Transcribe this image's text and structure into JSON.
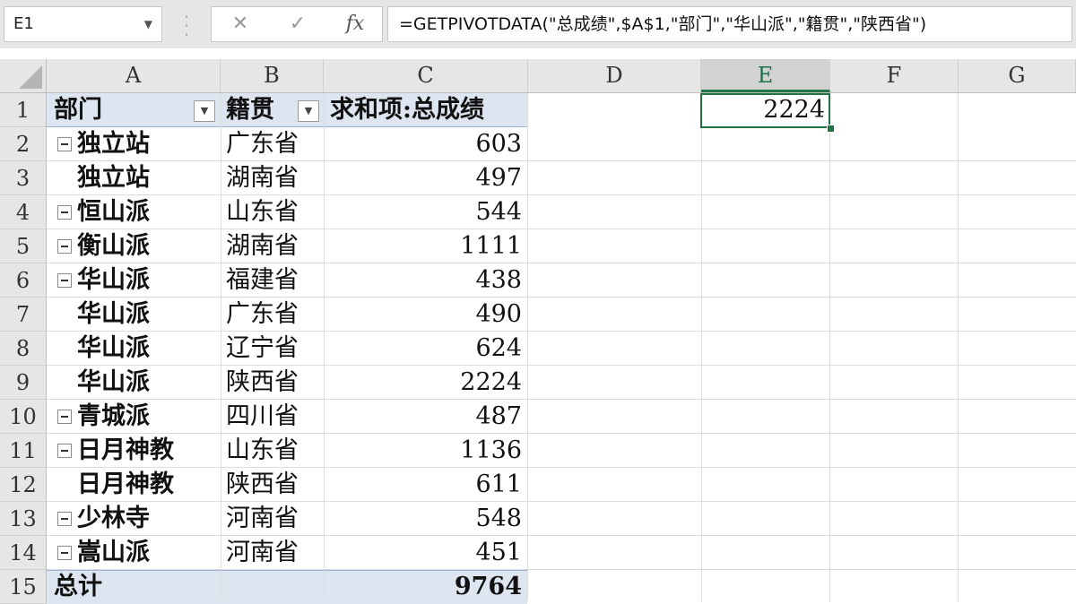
{
  "name_box": {
    "value": "E1"
  },
  "formula_bar": {
    "cancel_icon": "✕",
    "enter_icon": "✓",
    "fx_label": "fx",
    "formula": "=GETPIVOTDATA(\"总成绩\",$A$1,\"部门\",\"华山派\",\"籍贯\",\"陕西省\")"
  },
  "columns": [
    "A",
    "B",
    "C",
    "D",
    "E",
    "F",
    "G"
  ],
  "active_column": "E",
  "rows": [
    "1",
    "2",
    "3",
    "4",
    "5",
    "6",
    "7",
    "8",
    "9",
    "10",
    "11",
    "12",
    "13",
    "14",
    "15"
  ],
  "pivot": {
    "headers": {
      "dept": "部门",
      "origin": "籍贯",
      "sum": "求和项:总成绩"
    },
    "rows": [
      {
        "dept": "独立站",
        "origin": "广东省",
        "value": "603",
        "group_start": true
      },
      {
        "dept": "独立站",
        "origin": "湖南省",
        "value": "497",
        "group_start": false
      },
      {
        "dept": "恒山派",
        "origin": "山东省",
        "value": "544",
        "group_start": true
      },
      {
        "dept": "衡山派",
        "origin": "湖南省",
        "value": "1111",
        "group_start": true
      },
      {
        "dept": "华山派",
        "origin": "福建省",
        "value": "438",
        "group_start": true
      },
      {
        "dept": "华山派",
        "origin": "广东省",
        "value": "490",
        "group_start": false
      },
      {
        "dept": "华山派",
        "origin": "辽宁省",
        "value": "624",
        "group_start": false
      },
      {
        "dept": "华山派",
        "origin": "陕西省",
        "value": "2224",
        "group_start": false
      },
      {
        "dept": "青城派",
        "origin": "四川省",
        "value": "487",
        "group_start": true
      },
      {
        "dept": "日月神教",
        "origin": "山东省",
        "value": "1136",
        "group_start": true
      },
      {
        "dept": "日月神教",
        "origin": "陕西省",
        "value": "611",
        "group_start": false
      },
      {
        "dept": "少林寺",
        "origin": "河南省",
        "value": "548",
        "group_start": true
      },
      {
        "dept": "嵩山派",
        "origin": "河南省",
        "value": "451",
        "group_start": true
      }
    ],
    "total_label": "总计",
    "total_value": "9764"
  },
  "selected_cell": {
    "ref": "E1",
    "value": "2224"
  },
  "colors": {
    "accent": "#217346",
    "pivot_header_bg": "#dde5f0"
  }
}
